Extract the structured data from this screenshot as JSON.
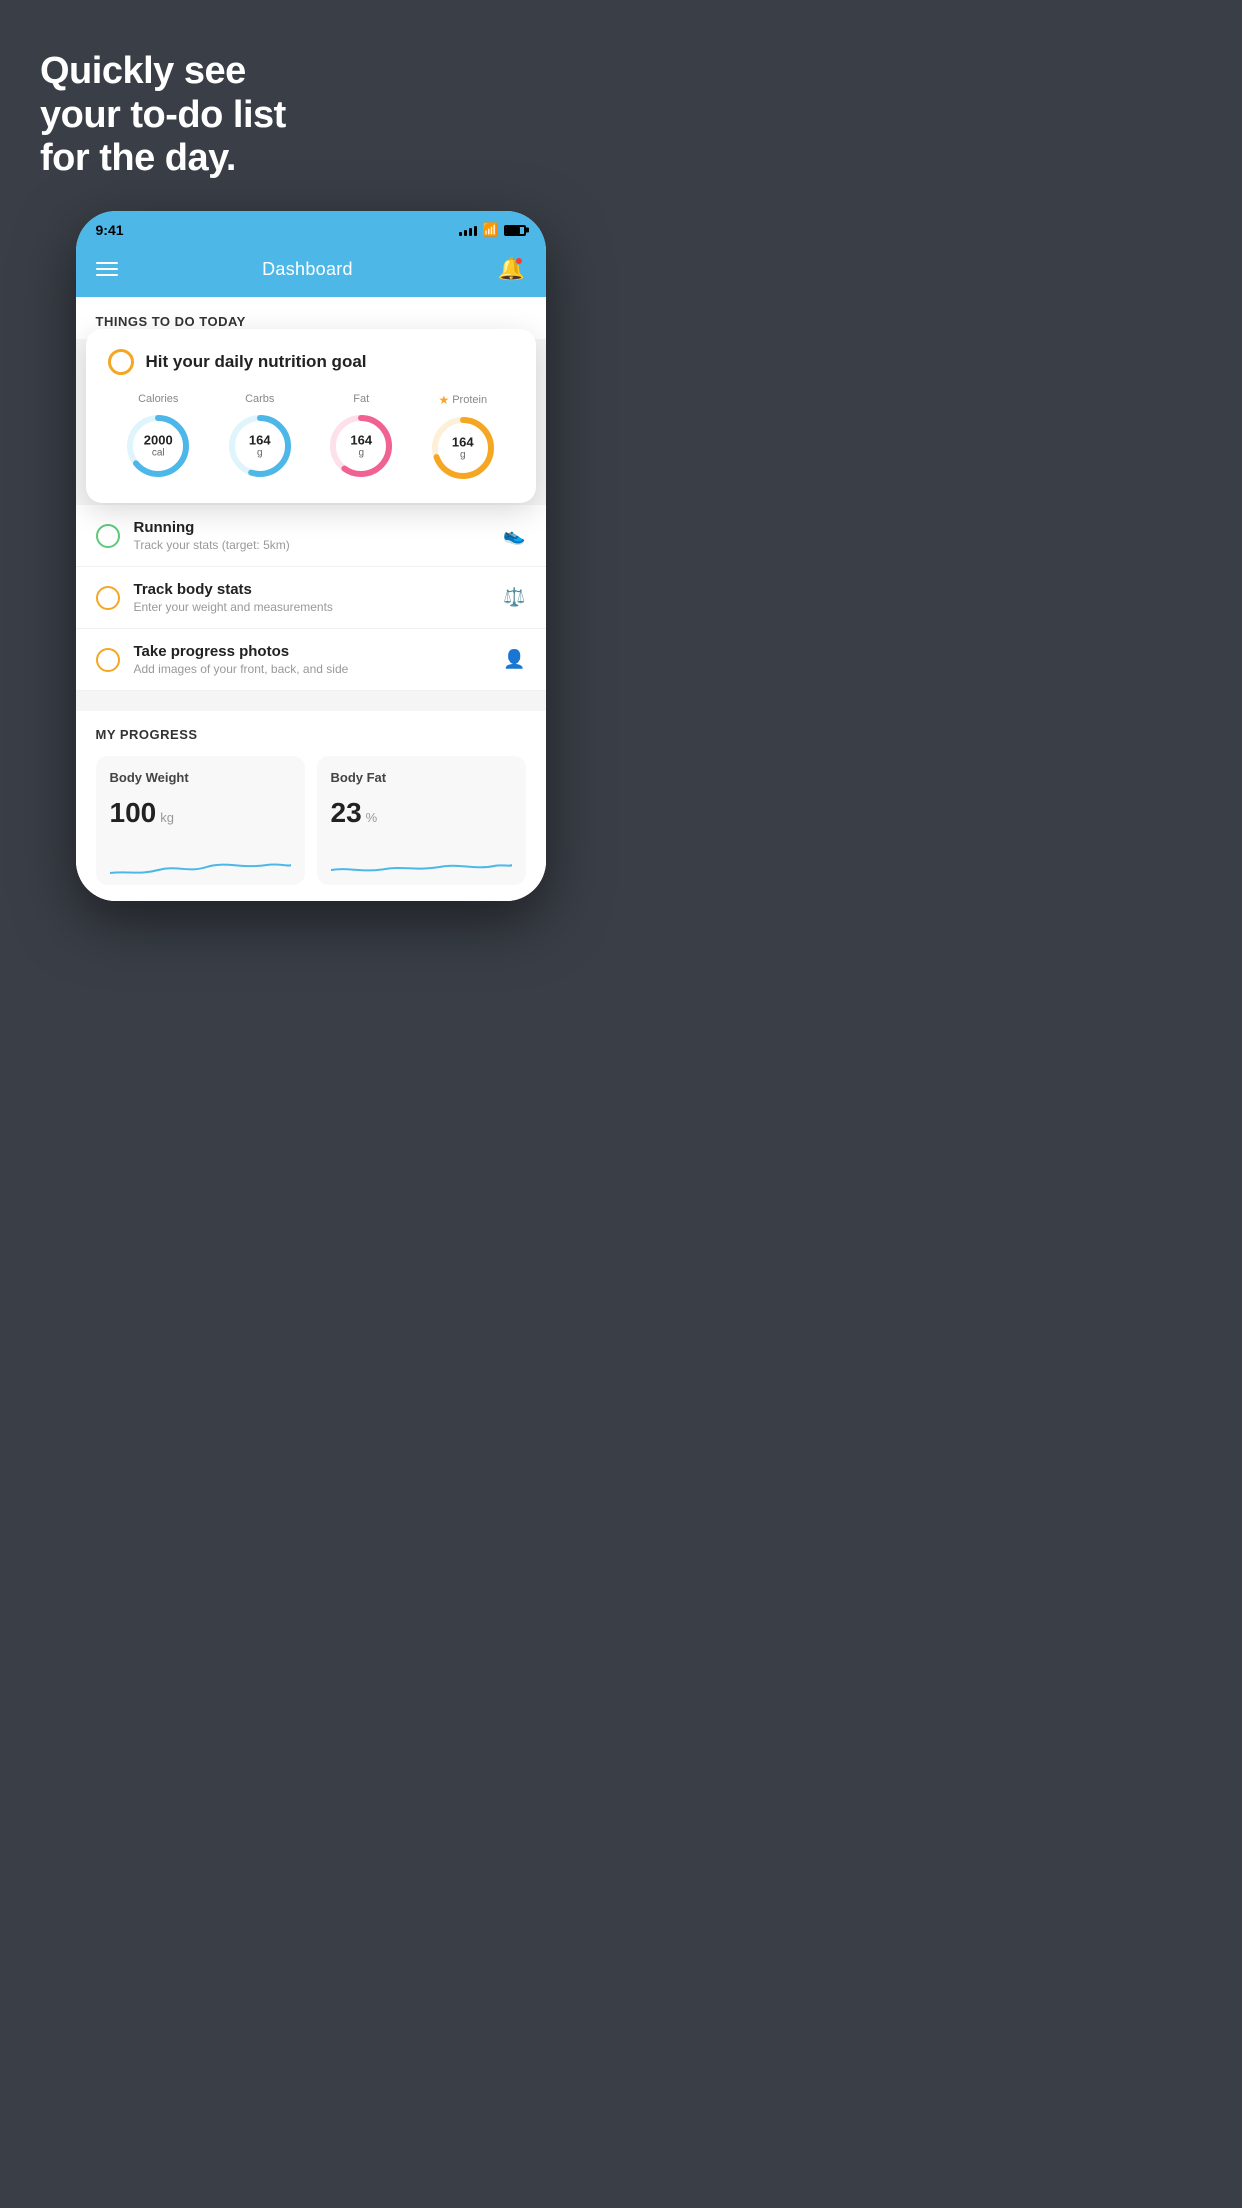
{
  "headline": {
    "line1": "Quickly see",
    "line2": "your to-do list",
    "line3": "for the day."
  },
  "statusBar": {
    "time": "9:41"
  },
  "nav": {
    "title": "Dashboard"
  },
  "thingsToDoHeader": "THINGS TO DO TODAY",
  "floatingCard": {
    "title": "Hit your daily nutrition goal",
    "items": [
      {
        "label": "Calories",
        "value": "2000",
        "unit": "cal",
        "color": "#4db8e8",
        "trackColor": "#e0f4fb",
        "progress": 65,
        "starred": false
      },
      {
        "label": "Carbs",
        "value": "164",
        "unit": "g",
        "color": "#4db8e8",
        "trackColor": "#e0f4fb",
        "progress": 55,
        "starred": false
      },
      {
        "label": "Fat",
        "value": "164",
        "unit": "g",
        "color": "#f06292",
        "trackColor": "#fde0ea",
        "progress": 60,
        "starred": false
      },
      {
        "label": "Protein",
        "value": "164",
        "unit": "g",
        "color": "#f5a623",
        "trackColor": "#fef0d8",
        "progress": 70,
        "starred": true
      }
    ]
  },
  "todoItems": [
    {
      "id": "running",
      "title": "Running",
      "subtitle": "Track your stats (target: 5km)",
      "circleColor": "green",
      "icon": "shoe"
    },
    {
      "id": "track-body-stats",
      "title": "Track body stats",
      "subtitle": "Enter your weight and measurements",
      "circleColor": "yellow",
      "icon": "scale"
    },
    {
      "id": "progress-photos",
      "title": "Take progress photos",
      "subtitle": "Add images of your front, back, and side",
      "circleColor": "yellow",
      "icon": "camera"
    }
  ],
  "progressSection": {
    "title": "MY PROGRESS",
    "cards": [
      {
        "title": "Body Weight",
        "value": "100",
        "unit": "kg"
      },
      {
        "title": "Body Fat",
        "value": "23",
        "unit": "%"
      }
    ]
  }
}
